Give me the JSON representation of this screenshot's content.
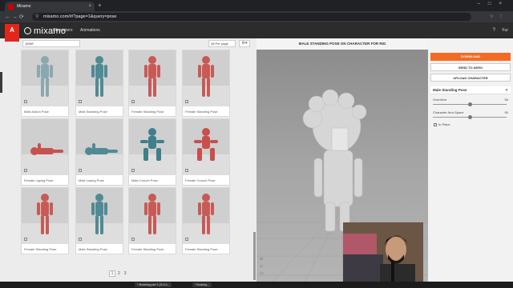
{
  "browser": {
    "tab_title": "Mixamo",
    "url": "mixamo.com/#/?page=1&query=pose"
  },
  "header": {
    "adobe_logo": "A",
    "brand": "mixamo",
    "nav": [
      "Characters",
      "Animations"
    ],
    "help": "?",
    "user": "Fur"
  },
  "toolbar": {
    "search_value": "pose",
    "per_page": "48 Per page"
  },
  "cards": [
    {
      "label": "Male Action Pose",
      "color": "#8aa8ae"
    },
    {
      "label": "Male Standing Pose",
      "color": "#4f8b95"
    },
    {
      "label": "Female Standing Pose",
      "color": "#c85a56"
    },
    {
      "label": "Female Standing Pose",
      "color": "#c85a56"
    },
    {
      "label": "Female Laying Pose",
      "color": "#c8504e"
    },
    {
      "label": "Male Laying Pose",
      "color": "#4f8b95"
    },
    {
      "label": "Male Crouch Pose",
      "color": "#3f7f8a"
    },
    {
      "label": "Female Crouch Pose",
      "color": "#c84f4c"
    },
    {
      "label": "Female Standing Pose",
      "color": "#c85a56"
    },
    {
      "label": "Male Standing Pose",
      "color": "#4f8b95"
    },
    {
      "label": "Female Standing Pose",
      "color": "#c85a56"
    },
    {
      "label": "Female Standing Pose",
      "color": "#c85a56"
    }
  ],
  "pager": {
    "current": "1",
    "pages": [
      "2",
      "3"
    ]
  },
  "viewer": {
    "title": "MALE STANDING POSE ON CHARACTER FOR RIG"
  },
  "panel": {
    "download": "DOWNLOAD",
    "send_to_aero": "SEND TO AERO",
    "upload": "UPLOAD CHARACTER",
    "section_title": "Male Standing Pose",
    "params": [
      {
        "label": "Overdrive",
        "value": "50",
        "fraction": 0.5
      },
      {
        "label": "Character Arm-Space",
        "value": "50",
        "fraction": 0.5
      }
    ],
    "in_place": "In Place"
  },
  "taskbar": {
    "items": [
      "* Modeling part 1 (D:/Co...",
      "* Booking..."
    ]
  }
}
